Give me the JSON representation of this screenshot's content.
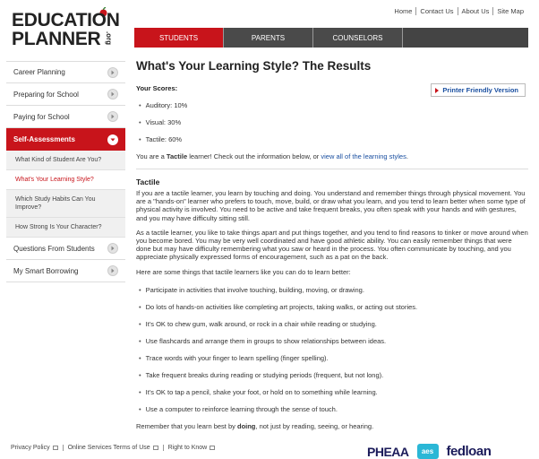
{
  "logo": {
    "line1": "EDUCATION",
    "line2": "PLANNER",
    "org": ".org"
  },
  "top_links": [
    "Home",
    "Contact Us",
    "About Us",
    "Site Map"
  ],
  "nav_tabs": [
    "STUDENTS",
    "PARENTS",
    "COUNSELORS"
  ],
  "sidebar": {
    "items": [
      {
        "label": "Career Planning"
      },
      {
        "label": "Preparing for School"
      },
      {
        "label": "Paying for School"
      },
      {
        "label": "Self-Assessments"
      }
    ],
    "sub_items": [
      "What Kind of Student Are You?",
      "What's Your Learning Style?",
      "Which Study Habits Can You Improve?",
      "How Strong Is Your Character?"
    ],
    "after_items": [
      "Questions From Students",
      "My Smart Borrowing"
    ]
  },
  "main": {
    "title": "What's Your Learning Style? The Results",
    "scores_heading": "Your Scores:",
    "printer_label": "Printer Friendly Version",
    "scores": [
      "Auditory: 10%",
      "Visual: 30%",
      "Tactile: 60%"
    ],
    "learner": {
      "prefix": "You are a ",
      "style": "Tactile",
      "middle": " learner! Check out the information below, or ",
      "link": "view all of the learning styles",
      "suffix": "."
    },
    "section_title": "Tactile",
    "para1": "If you are a tactile learner, you learn by touching and doing. You understand and remember things through physical movement. You are a \"hands-on\" learner who prefers to touch, move, build, or draw what you learn, and you tend to learn better when some type of physical activity is involved. You need to be active and take frequent breaks, you often speak with your hands and with gestures, and you may have difficulty sitting still.",
    "para2": "As a tactile learner, you like to take things apart and put things together, and you tend to find reasons to tinker or move around when you become bored. You may be very well coordinated and have good athletic ability. You can easily remember things that were done but may have difficulty remembering what you saw or heard in the process. You often communicate by touching, and you appreciate physically expressed forms of encouragement, such as a pat on the back.",
    "para3": "Here are some things that tactile learners like you can do to learn better:",
    "tips": [
      "Participate in activities that involve touching, building, moving, or drawing.",
      "Do lots of hands-on activities like completing art projects, taking walks, or acting out stories.",
      "It's OK to chew gum, walk around, or rock in a chair while reading or studying.",
      "Use flashcards and arrange them in groups to show relationships between ideas.",
      "Trace words with your finger to learn spelling (finger spelling).",
      "Take frequent breaks during reading or studying periods (frequent, but not long).",
      "It's OK to tap a pencil, shake your foot, or hold on to something while learning.",
      "Use a computer to reinforce learning through the sense of touch."
    ],
    "remember": {
      "prefix": "Remember that you learn best by ",
      "bold": "doing",
      "suffix": ", not just by reading, seeing, or hearing."
    }
  },
  "footer": {
    "links": [
      "Privacy Policy",
      "Online Services Terms of Use",
      "Right to Know"
    ],
    "partner_logos": [
      "PHEAA",
      "aes",
      "fedloan"
    ]
  },
  "colors": {
    "brand_red": "#c8141b",
    "nav_dark": "#4a4a4a",
    "link_blue": "#1a4fa0"
  }
}
